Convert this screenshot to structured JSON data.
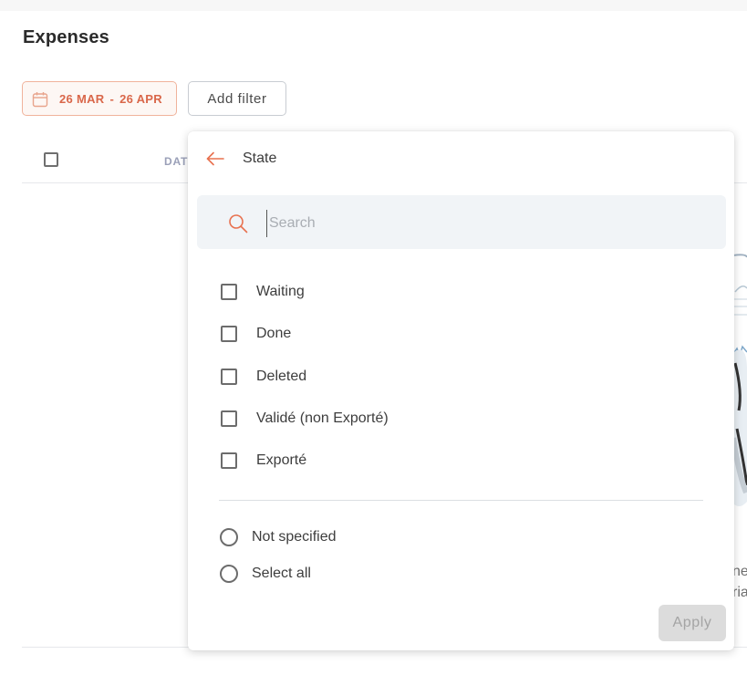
{
  "page": {
    "title": "Expenses"
  },
  "filters": {
    "date_range": {
      "start": "26 MAR",
      "separator": "-",
      "end": "26 APR"
    },
    "add_filter_label": "Add filter"
  },
  "table": {
    "columns": [
      "DAT"
    ]
  },
  "background_text": [
    "ne",
    "ria"
  ],
  "dropdown": {
    "title": "State",
    "search": {
      "placeholder": "Search",
      "value": ""
    },
    "options": [
      {
        "label": "Waiting",
        "checked": false
      },
      {
        "label": "Done",
        "checked": false
      },
      {
        "label": "Deleted",
        "checked": false
      },
      {
        "label": "Validé (non Exporté)",
        "checked": false
      },
      {
        "label": "Exporté",
        "checked": false
      }
    ],
    "radio_options": [
      {
        "label": "Not specified",
        "selected": false
      },
      {
        "label": "Select all",
        "selected": false
      }
    ],
    "apply_label": "Apply"
  },
  "colors": {
    "accent": "#e8714f",
    "date_text": "#d9674a",
    "search_bg": "#f1f4f7",
    "apply_disabled_bg": "#dcdcdc"
  },
  "icons": [
    "calendar-icon",
    "back-arrow-icon",
    "search-icon"
  ]
}
